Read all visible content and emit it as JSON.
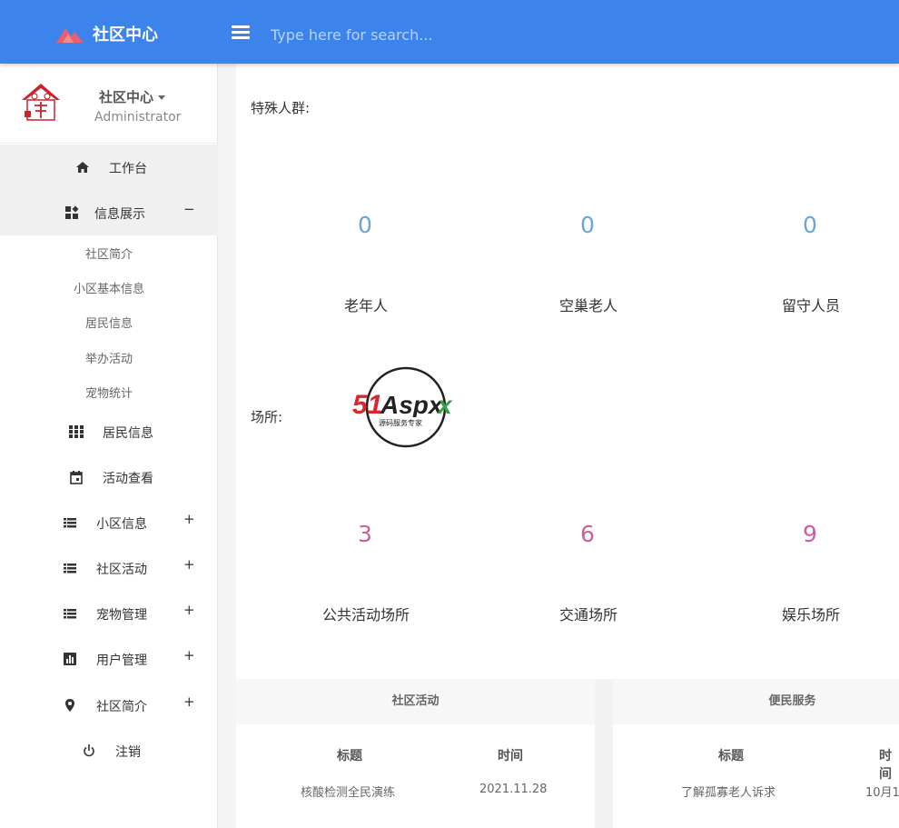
{
  "header": {
    "brand": "社区中心",
    "search_placeholder": "Type here for search..."
  },
  "profile": {
    "name": "社区中心",
    "role": "Administrator"
  },
  "sidebar": {
    "items": [
      {
        "label": "工作台",
        "icon": "home-icon"
      },
      {
        "label": "信息展示",
        "icon": "dashboard-icon",
        "toggle": "−"
      },
      {
        "label": "居民信息",
        "icon": "grid-icon"
      },
      {
        "label": "活动查看",
        "icon": "calendar-icon"
      },
      {
        "label": "小区信息",
        "icon": "list-icon",
        "toggle": "+"
      },
      {
        "label": "社区活动",
        "icon": "list-icon",
        "toggle": "+"
      },
      {
        "label": "宠物管理",
        "icon": "list-icon",
        "toggle": "+"
      },
      {
        "label": "用户管理",
        "icon": "bar-chart-icon",
        "toggle": "+"
      },
      {
        "label": "社区简介",
        "icon": "location-pin-icon",
        "toggle": "+"
      },
      {
        "label": "注销",
        "icon": "power-icon"
      }
    ],
    "subitems": [
      "社区简介",
      "小区基本信息",
      "居民信息",
      "举办活动",
      "宠物统计"
    ]
  },
  "main": {
    "special_label": "特殊人群:",
    "special_stats": [
      {
        "value": "0",
        "label": "老年人"
      },
      {
        "value": "0",
        "label": "空巢老人"
      },
      {
        "value": "0",
        "label": "留守人员"
      }
    ],
    "place_label": "场所:",
    "place_stats": [
      {
        "value": "3",
        "label": "公共活动场所"
      },
      {
        "value": "6",
        "label": "交通场所"
      },
      {
        "value": "9",
        "label": "娱乐场所"
      }
    ],
    "watermark": {
      "text": "51Aspx",
      "subtitle": "源码服务专家"
    }
  },
  "panels": {
    "activity": {
      "title": "社区活动",
      "headers": [
        "标题",
        "时间"
      ],
      "rows": [
        [
          "核酸检测全民演练",
          "2021.11.28"
        ]
      ]
    },
    "service": {
      "title": "便民服务",
      "headers": [
        "标题",
        "时间"
      ],
      "rows": [
        [
          "了解孤寡老人诉求",
          "10月1"
        ]
      ]
    }
  },
  "colors": {
    "topbar": "#3c83ec",
    "stat_blue": "#6ea4cf",
    "stat_pink": "#d05c9d"
  }
}
